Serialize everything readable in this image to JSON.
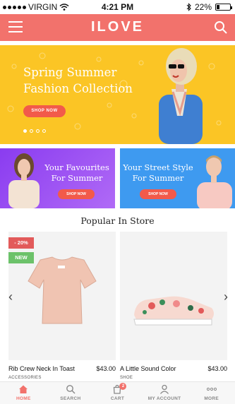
{
  "status_bar": {
    "carrier": "VIRGIN",
    "time": "4:21 PM",
    "battery_percent": "22%",
    "battery_level": 0.22
  },
  "header": {
    "title": "ILOVE",
    "accent_color": "#f2726c"
  },
  "hero": {
    "title_line1": "Spring Summer",
    "title_line2": "Fashion Collection",
    "cta": "SHOP NOW",
    "slide_count": 4,
    "active_slide": 0,
    "background": "#fbc525"
  },
  "promos": [
    {
      "line1": "Your Favourites",
      "line2": "For Summer",
      "cta": "SHOP NOW"
    },
    {
      "line1": "Your Street Style",
      "line2": "For Summer",
      "cta": "SHOP NOW"
    }
  ],
  "section": {
    "title": "Popular In Store"
  },
  "products": [
    {
      "name": "Rib Crew Neck In Toast",
      "price": "$43.00",
      "category": "ACCESSORIES",
      "badges": [
        "- 20%",
        "NEW"
      ]
    },
    {
      "name": "A Little Sound Color",
      "price": "$43.00",
      "category": "SHOE",
      "badges": []
    }
  ],
  "bottom_nav": {
    "items": [
      {
        "label": "HOME",
        "icon": "home-icon",
        "active": true
      },
      {
        "label": "SEARCH",
        "icon": "search-icon",
        "active": false
      },
      {
        "label": "CART",
        "icon": "cart-icon",
        "active": false,
        "count": "2"
      },
      {
        "label": "MY ACCOUNT",
        "icon": "account-icon",
        "active": false
      },
      {
        "label": "MORE",
        "icon": "more-icon",
        "active": false
      }
    ]
  }
}
